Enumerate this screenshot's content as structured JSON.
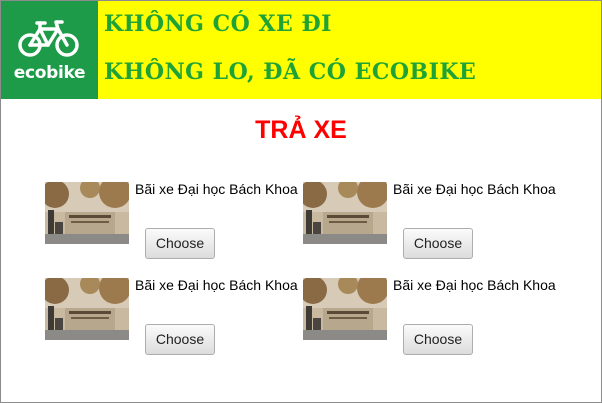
{
  "header": {
    "logo_text": "ecobike",
    "slogan_line1": "KHÔNG CÓ XE ĐI",
    "slogan_line2": "KHÔNG LO, ĐÃ CÓ ECOBIKE",
    "background_color": "#ffff00",
    "logo_color": "#1e9b48",
    "slogan_color": "#1fa336"
  },
  "page": {
    "title": "TRẢ XE",
    "title_color": "#ff0000"
  },
  "stations": [
    {
      "name": "Bãi xe Đại học Bách Khoa",
      "button_label": "Choose"
    },
    {
      "name": "Bãi xe Đại học Bách Khoa",
      "button_label": "Choose"
    },
    {
      "name": "Bãi xe Đại học Bách Khoa",
      "button_label": "Choose"
    },
    {
      "name": "Bãi xe Đại học Bách Khoa",
      "button_label": "Choose"
    }
  ]
}
